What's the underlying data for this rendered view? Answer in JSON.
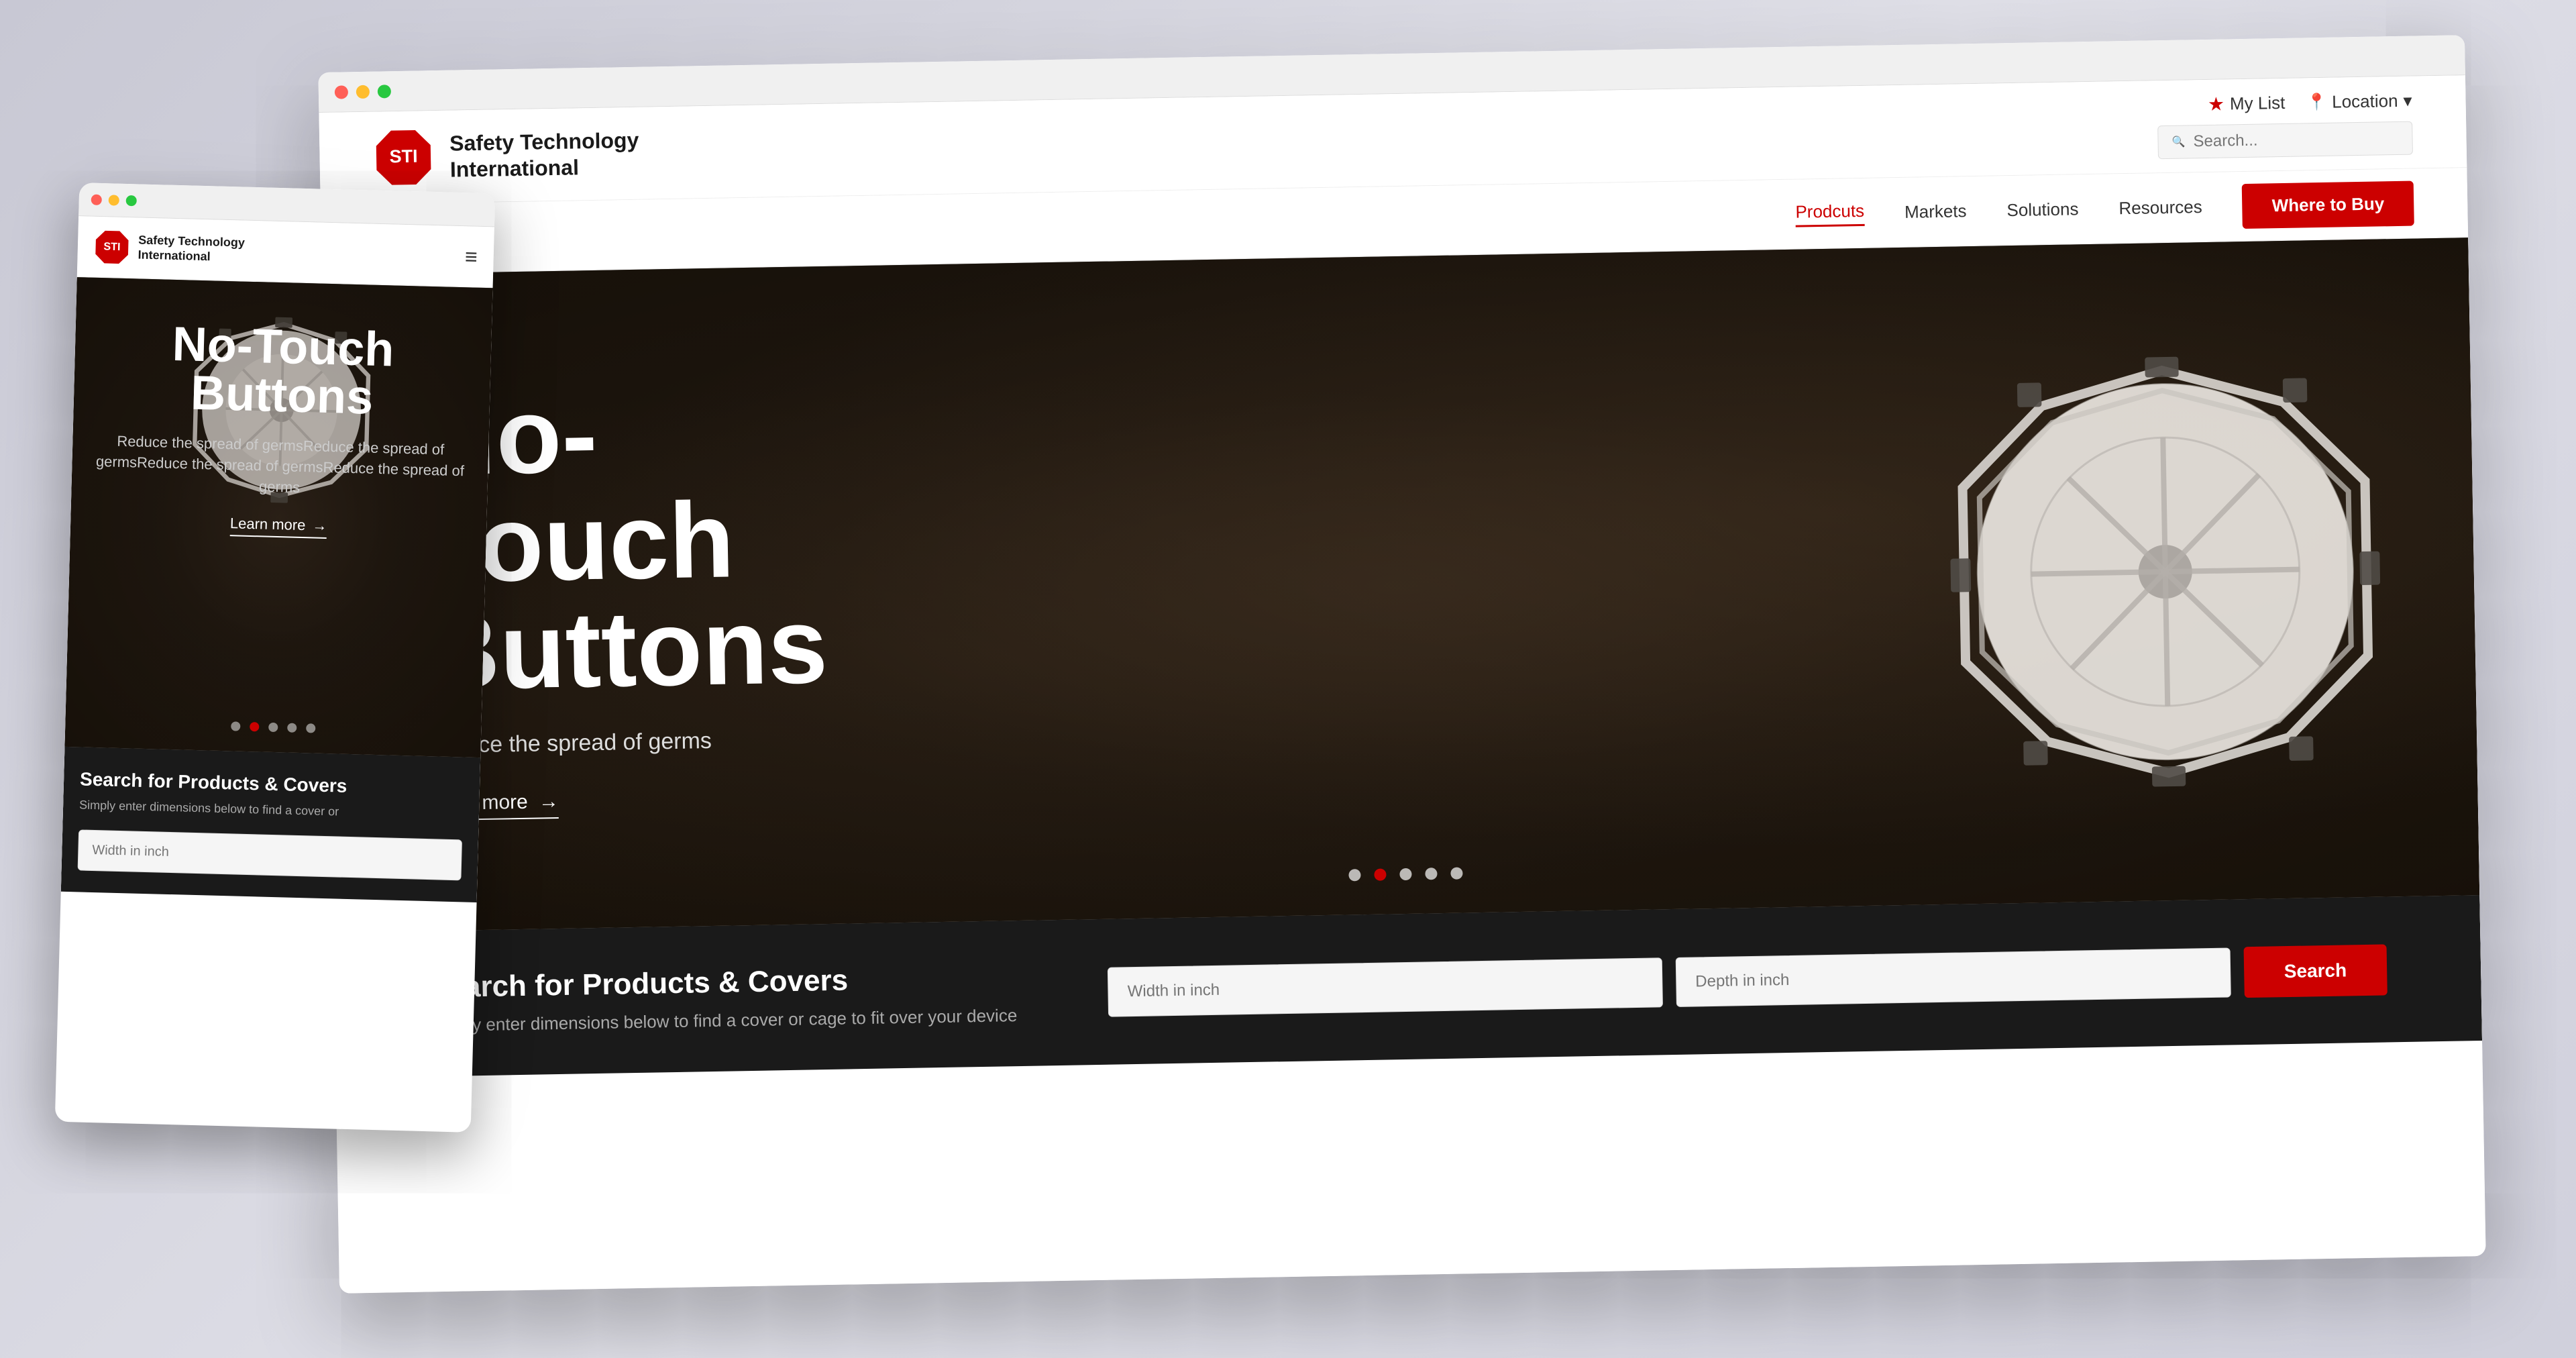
{
  "page": {
    "bg_color": "#d4d4dc"
  },
  "desktop": {
    "browser": {
      "dots": [
        "#ff5f57",
        "#ffbd2e",
        "#28c840"
      ]
    },
    "header": {
      "logo_text": "STI",
      "company_name_line1": "Safety Technology",
      "company_name_line2": "International",
      "my_list_label": "My List",
      "location_label": "Location",
      "search_placeholder": "Search..."
    },
    "nav": {
      "items": [
        {
          "label": "Prodcuts",
          "active": true
        },
        {
          "label": "Markets",
          "active": false
        },
        {
          "label": "Solutions",
          "active": false
        },
        {
          "label": "Resources",
          "active": false
        }
      ],
      "where_to_buy": "Where to Buy"
    },
    "hero": {
      "title_line1": "No-Touch",
      "title_line2": "Buttons",
      "subtitle": "Reduce the spread of germs",
      "learn_more": "Learn more",
      "dots": [
        false,
        true,
        false,
        false,
        false
      ]
    },
    "search_section": {
      "title": "Search for Products & Covers",
      "description": "Simply enter dimensions below to find a cover or cage to fit over your device",
      "width_placeholder": "Width in inch",
      "depth_placeholder": "Depth in inch",
      "button_label": "Search"
    }
  },
  "mobile": {
    "header": {
      "logo_text": "STI",
      "company_name_line1": "Safety Technology",
      "company_name_line2": "International"
    },
    "hero": {
      "title_line1": "No-Touch",
      "title_line2": "Buttons",
      "subtitle": "Reduce the spread of germsReduce the spread of germsReduce the spread of germsReduce the spread of germs",
      "learn_more": "Learn more",
      "dots": [
        false,
        true,
        false,
        false,
        false
      ]
    },
    "search_section": {
      "title": "Search for Products & Covers",
      "description": "Simply enter dimensions below to find a cover or"
    }
  }
}
